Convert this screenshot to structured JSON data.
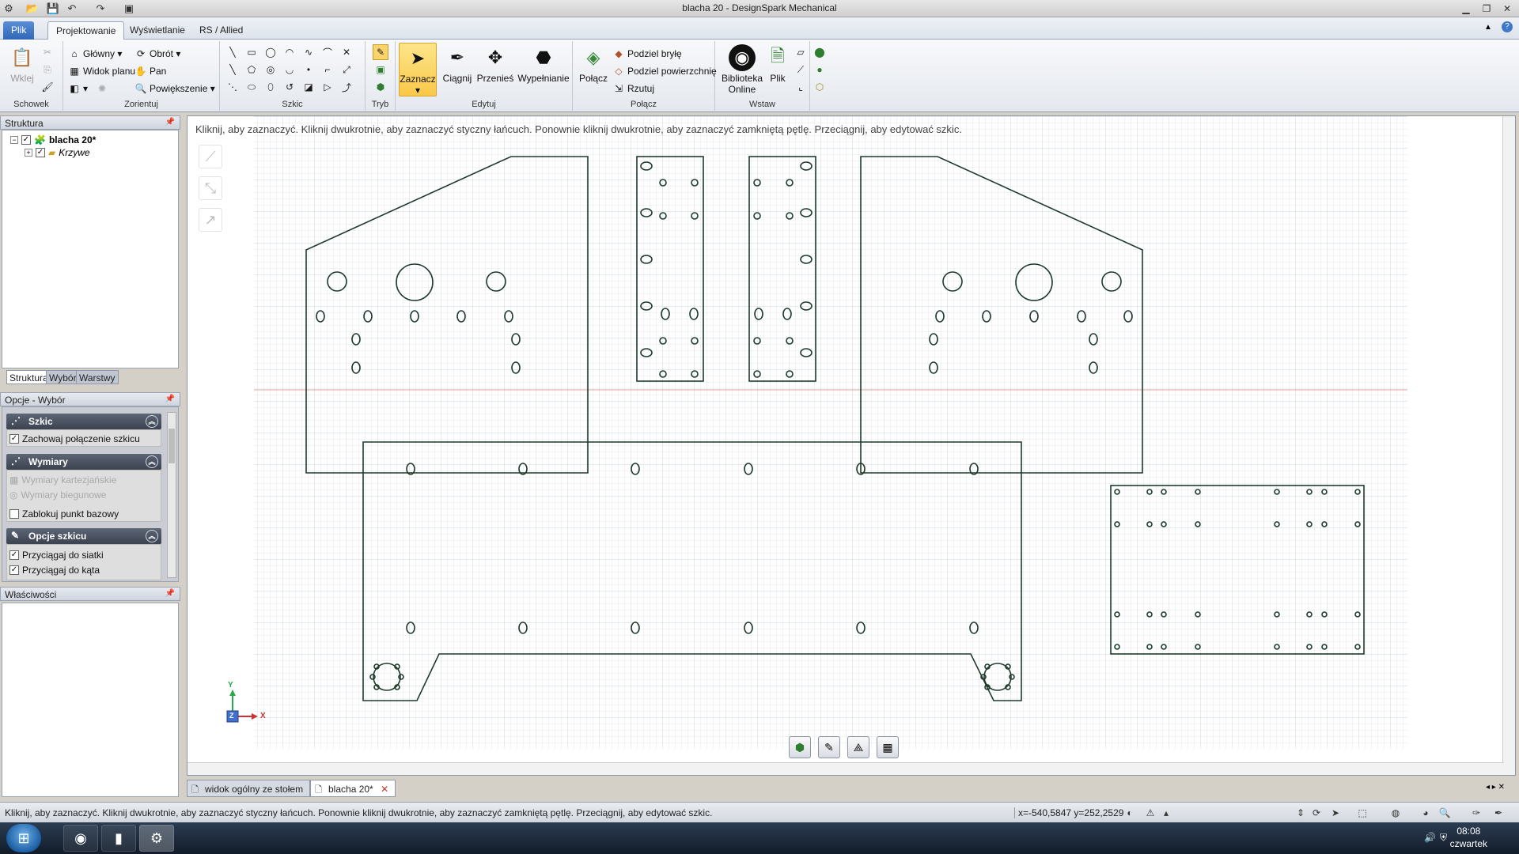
{
  "window": {
    "title": "blacha 20 - DesignSpark Mechanical"
  },
  "ribbon_tabs": [
    {
      "label": "Plik"
    },
    {
      "label": "Projektowanie"
    },
    {
      "label": "Wyświetlanie"
    },
    {
      "label": "RS / Allied"
    }
  ],
  "ribbon": {
    "schowek": {
      "label": "Schowek",
      "paste": "Wklej"
    },
    "zorientuj": {
      "label": "Zorientuj",
      "glowny": "Główny",
      "obrot": "Obrót",
      "widok_planu": "Widok planu",
      "pan": "Pan",
      "powiekszenie": "Powiększenie"
    },
    "szkic": {
      "label": "Szkic"
    },
    "tryb": {
      "label": "Tryb"
    },
    "edytuj": {
      "label": "Edytuj",
      "zaznacz": "Zaznacz",
      "ciagnij": "Ciągnij",
      "przenies": "Przenieś",
      "wypelnianie": "Wypełnianie"
    },
    "polacz": {
      "label": "Połącz",
      "polacz_btn": "Połącz",
      "podziel_bryle": "Podziel bryłę",
      "podziel_powierzchnie": "Podziel powierzchnię",
      "rzutuj": "Rzutuj"
    },
    "wstaw": {
      "label": "Wstaw",
      "biblioteka": "Biblioteka",
      "online": "Online",
      "plik": "Plik"
    }
  },
  "structure_panel": {
    "title": "Struktura",
    "root": "blacha 20*",
    "child": "Krzywe",
    "subtabs": [
      {
        "label": "Struktura"
      },
      {
        "label": "Wybór"
      },
      {
        "label": "Warstwy"
      }
    ]
  },
  "options_panel": {
    "title": "Opcje - Wybór",
    "sections": {
      "szkic": {
        "title": "Szkic",
        "opt1": "Zachowaj połączenie szkicu"
      },
      "wymiary": {
        "title": "Wymiary",
        "opt1": "Wymiary kartezjańskie",
        "opt2": "Wymiary biegunowe",
        "opt3": "Zablokuj punkt bazowy"
      },
      "opcje_szkicu": {
        "title": "Opcje szkicu",
        "opt1": "Przyciągaj do siatki",
        "opt2": "Przyciągaj do kąta"
      }
    }
  },
  "properties_panel": {
    "title": "Właściwości"
  },
  "canvas": {
    "hint": "Kliknij, aby zaznaczyć. Kliknij dwukrotnie, aby zaznaczyć styczny łańcuch. Ponownie kliknij dwukrotnie, aby zaznaczyć zamkniętą pętlę. Przeciągnij, aby edytować szkic.",
    "axis_x": "X",
    "axis_y": "Y",
    "axis_z": "Z"
  },
  "doc_tabs": [
    {
      "label": "widok ogólny ze stołem"
    },
    {
      "label": "blacha 20*"
    }
  ],
  "status": {
    "message": "Kliknij, aby zaznaczyć. Kliknij dwukrotnie, aby zaznaczyć styczny łańcuch. Ponownie kliknij dwukrotnie, aby zaznaczyć zamkniętą pętlę. Przeciągnij, aby edytować szkic.",
    "coords": "x=-540,5847  y=252,2529"
  },
  "taskbar": {
    "time": "08:08",
    "day": "czwartek"
  },
  "colors": {
    "sketch_line": "#1e3a2a",
    "grid": "#dfe3e8",
    "grid_major": "#c8ced6",
    "selected_tool": "#f9c84a"
  }
}
